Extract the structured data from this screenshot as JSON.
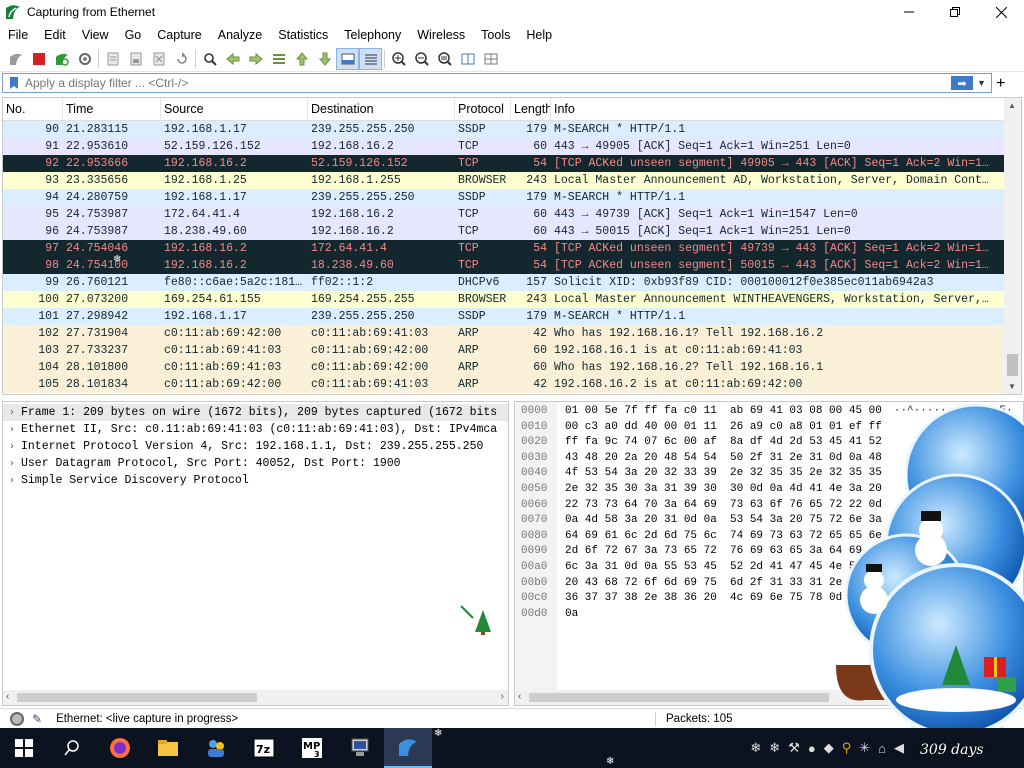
{
  "window": {
    "title": "Capturing from Ethernet",
    "controls": [
      "minimize",
      "maximize",
      "close"
    ]
  },
  "menu": [
    "File",
    "Edit",
    "View",
    "Go",
    "Capture",
    "Analyze",
    "Statistics",
    "Telephony",
    "Wireless",
    "Tools",
    "Help"
  ],
  "toolbar_icons": [
    "shark-fin-start-icon",
    "stop-icon",
    "restart-icon",
    "options-gear-icon",
    "open-file-icon",
    "save-file-icon",
    "close-file-icon",
    "reload-icon",
    "search-icon",
    "go-back-icon",
    "go-forward-icon",
    "go-to-packet-icon",
    "first-packet-icon",
    "last-packet-icon",
    "autoscroll-icon",
    "colorize-icon",
    "zoom-in-icon",
    "zoom-out-icon",
    "zoom-reset-icon",
    "resize-columns-icon",
    "layout-icon"
  ],
  "filter": {
    "placeholder": "Apply a display filter ... <Ctrl-/>"
  },
  "packet_list": {
    "columns": [
      "No.",
      "Time",
      "Source",
      "Destination",
      "Protocol",
      "Length",
      "Info"
    ],
    "rows": [
      {
        "no": "90",
        "time": "21.283115",
        "src": "192.168.1.17",
        "dst": "239.255.255.250",
        "proto": "SSDP",
        "len": "179",
        "info": "M-SEARCH * HTTP/1.1",
        "bg": "#daeeff",
        "fg": "#12272e"
      },
      {
        "no": "91",
        "time": "22.953610",
        "src": "52.159.126.152",
        "dst": "192.168.16.2",
        "proto": "TCP",
        "len": "60",
        "info": "443 → 49905 [ACK] Seq=1 Ack=1 Win=251 Len=0",
        "bg": "#e7e6ff",
        "fg": "#12272e"
      },
      {
        "no": "92",
        "time": "22.953666",
        "src": "192.168.16.2",
        "dst": "52.159.126.152",
        "proto": "TCP",
        "len": "54",
        "info": "[TCP ACKed unseen segment] 49905 → 443 [ACK] Seq=1 Ack=2 Win=1…",
        "bg": "#12272e",
        "fg": "#f78787"
      },
      {
        "no": "93",
        "time": "23.335656",
        "src": "192.168.1.25",
        "dst": "192.168.1.255",
        "proto": "BROWSER",
        "len": "243",
        "info": "Local Master Announcement AD, Workstation, Server, Domain Cont…",
        "bg": "#feffd0",
        "fg": "#12272e"
      },
      {
        "no": "94",
        "time": "24.280759",
        "src": "192.168.1.17",
        "dst": "239.255.255.250",
        "proto": "SSDP",
        "len": "179",
        "info": "M-SEARCH * HTTP/1.1",
        "bg": "#daeeff",
        "fg": "#12272e"
      },
      {
        "no": "95",
        "time": "24.753987",
        "src": "172.64.41.4",
        "dst": "192.168.16.2",
        "proto": "TCP",
        "len": "60",
        "info": "443 → 49739 [ACK] Seq=1 Ack=1 Win=1547 Len=0",
        "bg": "#e7e6ff",
        "fg": "#12272e"
      },
      {
        "no": "96",
        "time": "24.753987",
        "src": "18.238.49.60",
        "dst": "192.168.16.2",
        "proto": "TCP",
        "len": "60",
        "info": "443 → 50015 [ACK] Seq=1 Ack=1 Win=251 Len=0",
        "bg": "#e7e6ff",
        "fg": "#12272e"
      },
      {
        "no": "97",
        "time": "24.754046",
        "src": "192.168.16.2",
        "dst": "172.64.41.4",
        "proto": "TCP",
        "len": "54",
        "info": "[TCP ACKed unseen segment] 49739 → 443 [ACK] Seq=1 Ack=2 Win=1…",
        "bg": "#12272e",
        "fg": "#f78787"
      },
      {
        "no": "98",
        "time": "24.754100",
        "src": "192.168.16.2",
        "dst": "18.238.49.60",
        "proto": "TCP",
        "len": "54",
        "info": "[TCP ACKed unseen segment] 50015 → 443 [ACK] Seq=1 Ack=2 Win=1…",
        "bg": "#12272e",
        "fg": "#f78787"
      },
      {
        "no": "99",
        "time": "26.760121",
        "src": "fe80::c6ae:5a2c:181…",
        "dst": "ff02::1:2",
        "proto": "DHCPv6",
        "len": "157",
        "info": "Solicit XID: 0xb93f89 CID: 000100012f0e385ec011ab6942a3",
        "bg": "#daeeff",
        "fg": "#12272e"
      },
      {
        "no": "100",
        "time": "27.073200",
        "src": "169.254.61.155",
        "dst": "169.254.255.255",
        "proto": "BROWSER",
        "len": "243",
        "info": "Local Master Announcement WINTHEAVENGERS, Workstation, Server,…",
        "bg": "#feffd0",
        "fg": "#12272e"
      },
      {
        "no": "101",
        "time": "27.298942",
        "src": "192.168.1.17",
        "dst": "239.255.255.250",
        "proto": "SSDP",
        "len": "179",
        "info": "M-SEARCH * HTTP/1.1",
        "bg": "#daeeff",
        "fg": "#12272e"
      },
      {
        "no": "102",
        "time": "27.731904",
        "src": "c0:11:ab:69:42:00",
        "dst": "c0:11:ab:69:41:03",
        "proto": "ARP",
        "len": "42",
        "info": "Who has 192.168.16.1? Tell 192.168.16.2",
        "bg": "#faf0d7",
        "fg": "#12272e"
      },
      {
        "no": "103",
        "time": "27.733237",
        "src": "c0:11:ab:69:41:03",
        "dst": "c0:11:ab:69:42:00",
        "proto": "ARP",
        "len": "60",
        "info": "192.168.16.1 is at c0:11:ab:69:41:03",
        "bg": "#faf0d7",
        "fg": "#12272e"
      },
      {
        "no": "104",
        "time": "28.101800",
        "src": "c0:11:ab:69:41:03",
        "dst": "c0:11:ab:69:42:00",
        "proto": "ARP",
        "len": "60",
        "info": "Who has 192.168.16.2? Tell 192.168.16.1",
        "bg": "#faf0d7",
        "fg": "#12272e"
      },
      {
        "no": "105",
        "time": "28.101834",
        "src": "c0:11:ab:69:42:00",
        "dst": "c0:11:ab:69:41:03",
        "proto": "ARP",
        "len": "42",
        "info": "192.168.16.2 is at c0:11:ab:69:42:00",
        "bg": "#faf0d7",
        "fg": "#12272e"
      }
    ]
  },
  "details": [
    "Frame 1: 209 bytes on wire (1672 bits), 209 bytes captured (1672 bits",
    "Ethernet II, Src: c0.11:ab:69:41:03 (c0:11:ab:69:41:03), Dst: IPv4mca",
    "Internet Protocol Version 4, Src: 192.168.1.1, Dst: 239.255.255.250",
    "User Datagram Protocol, Src Port: 40052, Dst Port: 1900",
    "Simple Service Discovery Protocol"
  ],
  "bytes": [
    {
      "off": "0000",
      "hex": "01 00 5e 7f ff fa c0 11  ab 69 41 03 08 00 45 00",
      "asc": "··^·····  ·iA···E·"
    },
    {
      "off": "0010",
      "hex": "00 c3 a0 dd 40 00 01 11  26 a9 c0 a8 01 01 ef ff",
      "asc": ""
    },
    {
      "off": "0020",
      "hex": "ff fa 9c 74 07 6c 00 af  8a df 4d 2d 53 45 41 52",
      "asc": ""
    },
    {
      "off": "0030",
      "hex": "43 48 20 2a 20 48 54 54  50 2f 31 2e 31 0d 0a 48",
      "asc": ""
    },
    {
      "off": "0040",
      "hex": "4f 53 54 3a 20 32 33 39  2e 32 35 35 2e 32 35 35",
      "asc": ""
    },
    {
      "off": "0050",
      "hex": "2e 32 35 30 3a 31 39 30  30 0d 0a 4d 41 4e 3a 20",
      "asc": ""
    },
    {
      "off": "0060",
      "hex": "22 73 73 64 70 3a 64 69  73 63 6f 76 65 72 22 0d",
      "asc": ""
    },
    {
      "off": "0070",
      "hex": "0a 4d 58 3a 20 31 0d 0a  53 54 3a 20 75 72 6e 3a",
      "asc": ""
    },
    {
      "off": "0080",
      "hex": "64 69 61 6c 2d 6d 75 6c  74 69 73 63 72 65 65 6e",
      "asc": ""
    },
    {
      "off": "0090",
      "hex": "2d 6f 72 67 3a 73 65 72  76 69 63 65 3a 64 69 61",
      "asc": ""
    },
    {
      "off": "00a0",
      "hex": "6c 3a 31 0d 0a 55 53 45  52 2d 41 47 45 4e 54 3a",
      "asc": ""
    },
    {
      "off": "00b0",
      "hex": "20 43 68 72 6f 6d 69 75  6d 2f 31 33 31 2e 30 2e",
      "asc": ""
    },
    {
      "off": "00c0",
      "hex": "36 37 37 38 2e 38 36 20  4c 69 6e 75 78 0d 0a 0d",
      "asc": ""
    },
    {
      "off": "00d0",
      "hex": "0a",
      "asc": ""
    }
  ],
  "status": {
    "capture_text": "Ethernet: <live capture in progress>",
    "packets_text": "Packets: 105"
  },
  "taskbar": {
    "apps": [
      "windows-start-icon",
      "search-icon",
      "firefox-icon",
      "file-explorer-icon",
      "people-app-icon",
      "7zip-icon",
      "mp3-app-icon",
      "network-monitor-icon",
      "wireshark-icon"
    ],
    "days_text": "309 days"
  }
}
